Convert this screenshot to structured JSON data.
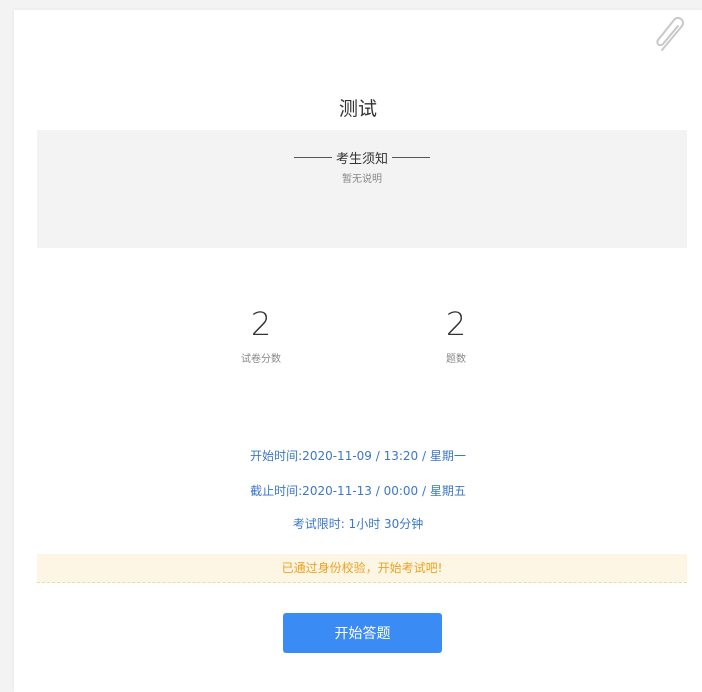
{
  "exam": {
    "title": "测试"
  },
  "notice": {
    "heading": "考生须知",
    "body": "暂无说明"
  },
  "stats": {
    "score_value": "2",
    "score_label": "试卷分数",
    "count_value": "2",
    "count_label": "题数"
  },
  "info": {
    "start_time": "开始时间:2020-11-09 / 13:20 / 星期一",
    "end_time": "截止时间:2020-11-13 / 00:00 / 星期五",
    "time_limit": "考试限时: 1小时 30分钟"
  },
  "banner": {
    "message": "已通过身份校验，开始考试吧!"
  },
  "actions": {
    "start_label": "开始答题"
  },
  "icons": {
    "corner": "paperclip-icon"
  },
  "colors": {
    "accent": "#3b8bf5",
    "info_text": "#3a78c8",
    "banner_bg": "#fdf6e4",
    "banner_text": "#f0a020"
  }
}
